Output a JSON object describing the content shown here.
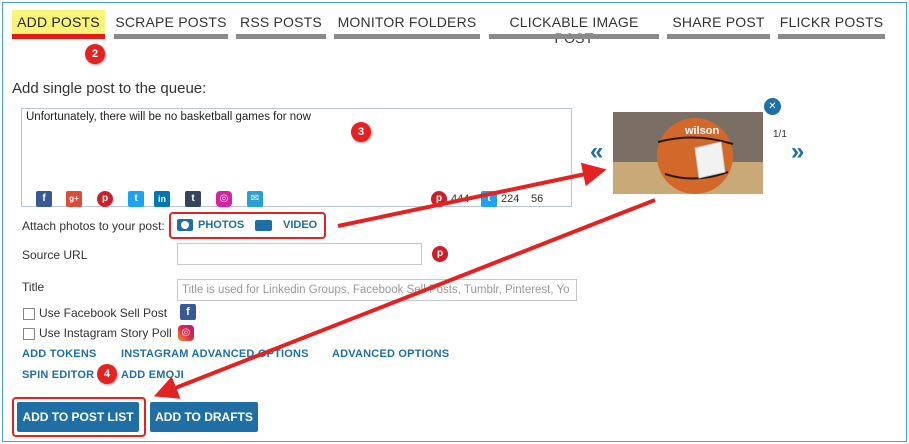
{
  "tabs": [
    {
      "label": "ADD POSTS",
      "active": true
    },
    {
      "label": "SCRAPE POSTS"
    },
    {
      "label": "RSS POSTS"
    },
    {
      "label": "MONITOR FOLDERS"
    },
    {
      "label": "CLICKABLE IMAGE POST"
    },
    {
      "label": "SHARE POST"
    },
    {
      "label": "FLICKR POSTS"
    }
  ],
  "badges": {
    "tab": "2",
    "textarea": "3",
    "submit": "4"
  },
  "heading": "Add single post to the queue:",
  "post_text": "Unfortunately, there will be no basketball games for now",
  "social_icons": [
    "facebook-icon",
    "google-plus-icon",
    "pinterest-icon",
    "twitter-icon",
    "linkedin-icon",
    "tumblr-icon",
    "instagram-icon",
    "email-icon"
  ],
  "counters": {
    "pinterest": "444",
    "twitter": "224",
    "other": "56"
  },
  "attach": {
    "label": "Attach photos to your post:",
    "photos": "PHOTOS",
    "video": "VIDEO"
  },
  "source_url": {
    "label": "Source URL",
    "value": ""
  },
  "title": {
    "label": "Title",
    "placeholder": "Title is used for Linkedin Groups, Facebook Sell Posts, Tumblr, Pinterest, Yo"
  },
  "checkboxes": {
    "facebook_sell": "Use Facebook Sell Post",
    "instagram_poll": "Use Instagram Story Poll"
  },
  "links": {
    "add_tokens": "ADD TOKENS",
    "instagram_advanced": "INSTAGRAM ADVANCED OPTIONS",
    "advanced": "ADVANCED OPTIONS",
    "spin_editor": "SPIN EDITOR",
    "add_emoji": "ADD EMOJI"
  },
  "image": {
    "counter": "1/1",
    "prev": "«",
    "next": "»",
    "close": "✕"
  },
  "buttons": {
    "add_to_post_list": "ADD TO POST LIST",
    "add_to_drafts": "ADD TO DRAFTS"
  },
  "colors": {
    "accent": "#1f6fa4",
    "callout": "#e32323",
    "tab_highlight": "#f8f47a"
  }
}
